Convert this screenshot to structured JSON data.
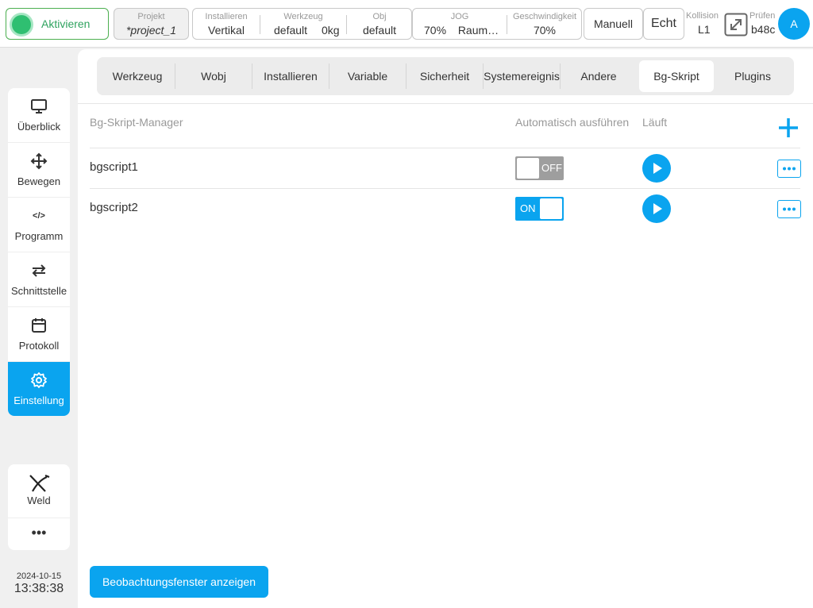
{
  "topbar": {
    "activate_label": "Aktivieren",
    "project": {
      "caption": "Projekt",
      "value": "*project_1"
    },
    "install": {
      "installieren": {
        "caption": "Installieren",
        "value": "Vertikal"
      },
      "werkzeug": {
        "caption": "Werkzeug",
        "value": "default",
        "value2": "0kg"
      },
      "obj": {
        "caption": "Obj",
        "value": "default"
      }
    },
    "jog": {
      "caption": "JOG",
      "percent": "70%",
      "mode": "Raum…"
    },
    "speed": {
      "caption": "Geschwindigkeit",
      "value": "70%"
    },
    "manual_label": "Manuell",
    "echt_label": "Echt",
    "collision": {
      "caption": "Kollision",
      "value": "L1"
    },
    "check": {
      "caption": "Prüfen",
      "value": "b48c"
    },
    "avatar_label": "A"
  },
  "sidebar": {
    "items": [
      {
        "label": "Überblick",
        "icon": "monitor-icon"
      },
      {
        "label": "Bewegen",
        "icon": "move-icon"
      },
      {
        "label": "Programm",
        "icon": "code-icon"
      },
      {
        "label": "Schnittstelle",
        "icon": "swap-icon"
      },
      {
        "label": "Protokoll",
        "icon": "calendar-icon"
      },
      {
        "label": "Einstellung",
        "icon": "gear-icon"
      }
    ],
    "code_glyph": "</>",
    "weld_label": "Weld",
    "more_label": "•••"
  },
  "clock": {
    "date": "2024-10-15",
    "time": "13:38:38"
  },
  "tabs": [
    "Werkzeug",
    "Wobj",
    "Installieren",
    "Variable",
    "Sicherheit",
    "Systemereignis",
    "Andere",
    "Bg-Skript",
    "Plugins"
  ],
  "active_tab": "Bg-Skript",
  "manager": {
    "col_name": "Bg-Skript-Manager",
    "col_auto": "Automatisch ausführen",
    "col_run": "Läuft",
    "rows": [
      {
        "name": "bgscript1",
        "auto": "OFF"
      },
      {
        "name": "bgscript2",
        "auto": "ON"
      }
    ]
  },
  "watch_button": "Beobachtungsfenster anzeigen",
  "colors": {
    "accent": "#0aa4ef",
    "active_green": "#2fbf71",
    "toggle_off": "#9e9e9e"
  }
}
